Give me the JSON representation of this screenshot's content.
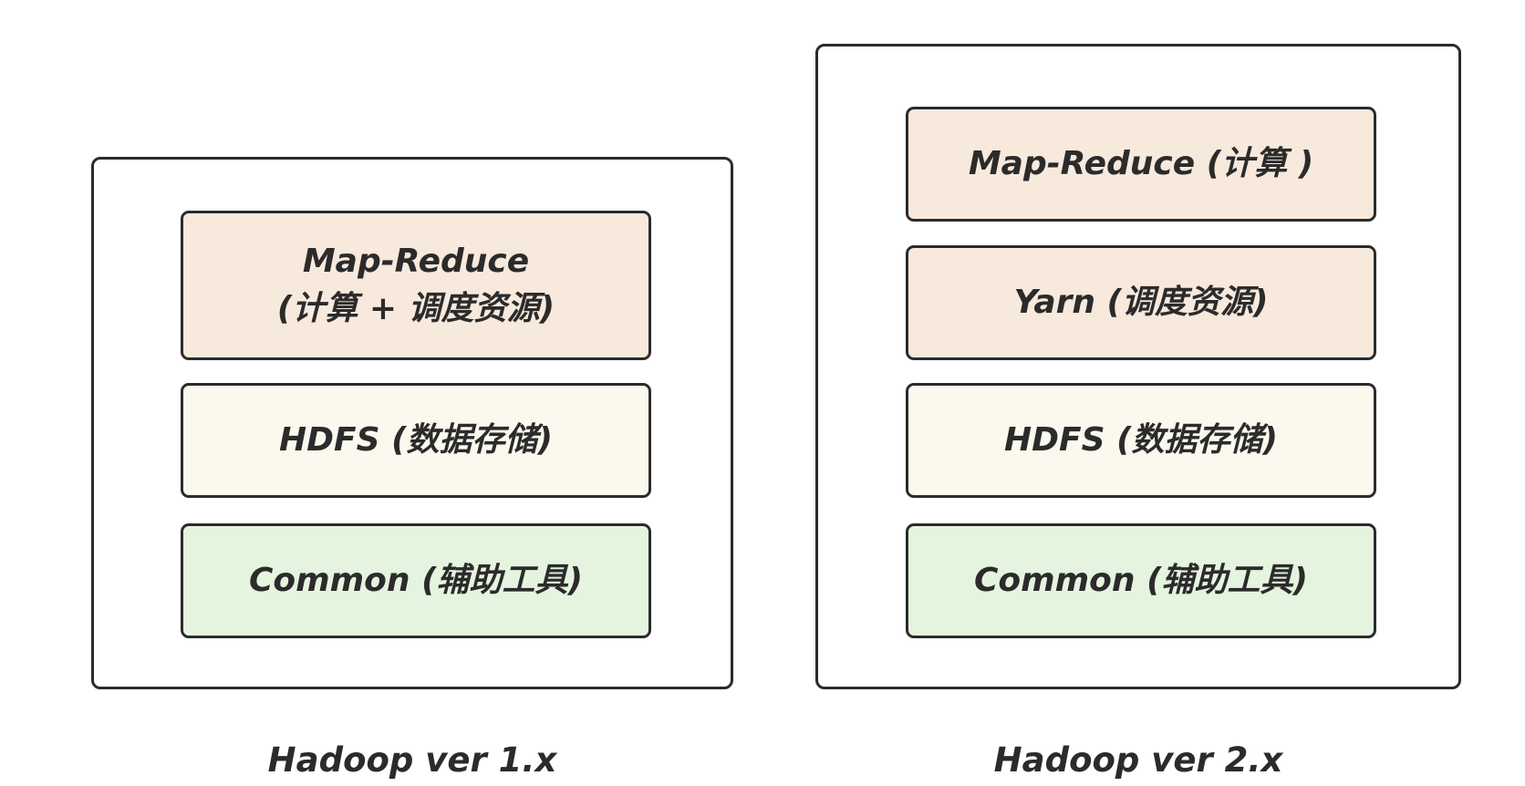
{
  "stacks": [
    {
      "caption": "Hadoop ver 1.x",
      "layers": [
        {
          "line1": "Map-Reduce",
          "line2": "(计算 + 调度资源)",
          "color": "#f8e9dd"
        },
        {
          "line1": "HDFS (数据存储)",
          "color": "#fbf9ee"
        },
        {
          "line1": "Common (辅助工具)",
          "color": "#e5f4df"
        }
      ]
    },
    {
      "caption": "Hadoop ver 2.x",
      "layers": [
        {
          "line1": "Map-Reduce (计算 )",
          "color": "#f8e9dd"
        },
        {
          "line1": "Yarn (调度资源)",
          "color": "#f8e9dd"
        },
        {
          "line1": "HDFS (数据存储)",
          "color": "#fbf9ee"
        },
        {
          "line1": "Common (辅助工具)",
          "color": "#e5f4df"
        }
      ]
    }
  ],
  "colors": {
    "border": "#2b2b2b",
    "text": "#2b2b2b",
    "background": "#ffffff"
  }
}
